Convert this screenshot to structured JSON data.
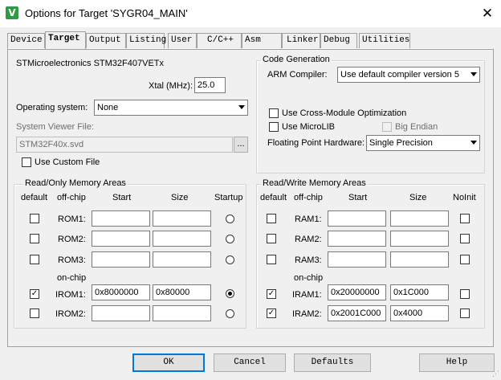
{
  "window": {
    "title": "Options for Target 'SYGR04_MAIN'",
    "icon": "V",
    "close": "✕"
  },
  "tabs": [
    {
      "label": "Device",
      "active": false
    },
    {
      "label": "Target",
      "active": true
    },
    {
      "label": "Output",
      "active": false
    },
    {
      "label": "Listing",
      "active": false
    },
    {
      "label": "User",
      "active": false
    },
    {
      "label": "C/C++",
      "active": false
    },
    {
      "label": "Asm",
      "active": false
    },
    {
      "label": "Linker",
      "active": false
    },
    {
      "label": "Debug",
      "active": false
    },
    {
      "label": "Utilities",
      "active": false
    }
  ],
  "device": {
    "name": "STMicroelectronics STM32F407VETx",
    "xtal_label": "Xtal (MHz):",
    "xtal_value": "25.0",
    "os_label": "Operating system:",
    "os_value": "None",
    "svf_label": "System Viewer File:",
    "svf_value": "STM32F40x.svd",
    "browse": "...",
    "use_custom_file": "Use Custom File"
  },
  "code_generation": {
    "legend": "Code Generation",
    "arm_compiler_label": "ARM Compiler:",
    "arm_compiler_value": "Use default compiler version 5",
    "cross_module": "Use Cross-Module Optimization",
    "microlib": "Use MicroLIB",
    "big_endian": "Big Endian",
    "fph_label": "Floating Point Hardware:",
    "fph_value": "Single Precision"
  },
  "rom": {
    "legend": "Read/Only Memory Areas",
    "headers": {
      "default": "default",
      "offchip": "off-chip",
      "start": "Start",
      "size": "Size",
      "startup": "Startup"
    },
    "onchip_label": "on-chip",
    "rows": [
      {
        "label": "ROM1:",
        "start": "",
        "size": "",
        "default": false,
        "startup": false
      },
      {
        "label": "ROM2:",
        "start": "",
        "size": "",
        "default": false,
        "startup": false
      },
      {
        "label": "ROM3:",
        "start": "",
        "size": "",
        "default": false,
        "startup": false
      },
      {
        "label": "IROM1:",
        "start": "0x8000000",
        "size": "0x80000",
        "default": true,
        "startup": true
      },
      {
        "label": "IROM2:",
        "start": "",
        "size": "",
        "default": false,
        "startup": false
      }
    ]
  },
  "ram": {
    "legend": "Read/Write Memory Areas",
    "headers": {
      "default": "default",
      "offchip": "off-chip",
      "start": "Start",
      "size": "Size",
      "noinit": "NoInit"
    },
    "onchip_label": "on-chip",
    "rows": [
      {
        "label": "RAM1:",
        "start": "",
        "size": "",
        "default": false,
        "noinit": false
      },
      {
        "label": "RAM2:",
        "start": "",
        "size": "",
        "default": false,
        "noinit": false
      },
      {
        "label": "RAM3:",
        "start": "",
        "size": "",
        "default": false,
        "noinit": false
      },
      {
        "label": "IRAM1:",
        "start": "0x20000000",
        "size": "0x1C000",
        "default": true,
        "noinit": false
      },
      {
        "label": "IRAM2:",
        "start": "0x2001C000",
        "size": "0x4000",
        "default": true,
        "noinit": false
      }
    ]
  },
  "buttons": {
    "ok": "OK",
    "cancel": "Cancel",
    "defaults": "Defaults",
    "help": "Help"
  }
}
